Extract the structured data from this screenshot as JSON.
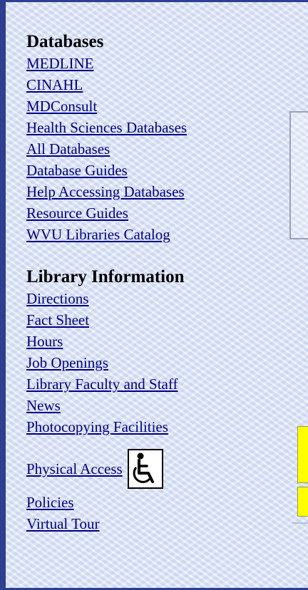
{
  "databases": {
    "heading": "Databases",
    "links": [
      "MEDLINE",
      "CINAHL",
      "MDConsult",
      "Health Sciences Databases",
      "All Databases",
      "Database Guides",
      "Help Accessing Databases",
      "Resource Guides",
      "WVU Libraries Catalog"
    ]
  },
  "library_info": {
    "heading": "Library Information",
    "links": [
      "Directions",
      "Fact Sheet",
      "Hours",
      "Job Openings",
      "Library Faculty and Staff",
      "News",
      "Photocopying Facilities"
    ],
    "physical_access": "Physical Access",
    "more_links": [
      "Policies",
      "Virtual Tour"
    ]
  },
  "icons": {
    "accessibility": "wheelchair-icon"
  },
  "colors": {
    "link": "#000080",
    "highlight": "#ffff00",
    "frame": "#2e3f8f"
  }
}
